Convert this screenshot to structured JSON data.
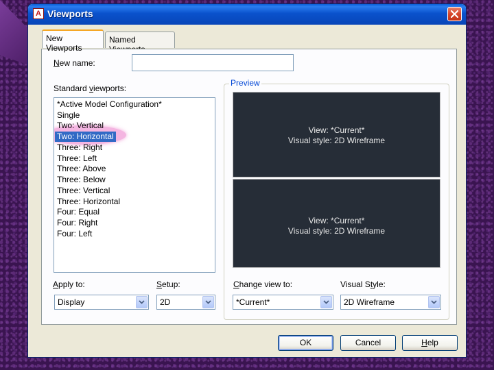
{
  "window": {
    "title": "Viewports",
    "app_icon_letter": "A"
  },
  "tabs": [
    {
      "label": "New Viewports",
      "active": true
    },
    {
      "label": "Named Viewports",
      "active": false
    }
  ],
  "new_name": {
    "label_pre": "",
    "label_mn": "N",
    "label_post": "ew name:",
    "value": ""
  },
  "standard_viewports": {
    "label_pre": "Standard ",
    "label_mn": "v",
    "label_post": "iewports:",
    "items": [
      "*Active Model Configuration*",
      "Single",
      "Two: Vertical",
      "Two: Horizontal",
      "Three: Right",
      "Three: Left",
      "Three: Above",
      "Three: Below",
      "Three: Vertical",
      "Three: Horizontal",
      "Four: Equal",
      "Four: Right",
      "Four: Left"
    ],
    "selected_index": 3
  },
  "preview": {
    "title": "Preview",
    "panes": [
      {
        "view": "View: *Current*",
        "style": "Visual style: 2D Wireframe"
      },
      {
        "view": "View: *Current*",
        "style": "Visual style: 2D Wireframe"
      }
    ],
    "background_color": "#262d37"
  },
  "apply_to": {
    "label_pre": "",
    "label_mn": "A",
    "label_post": "pply to:",
    "value": "Display"
  },
  "setup": {
    "label_pre": "",
    "label_mn": "S",
    "label_post": "etup:",
    "value": "2D"
  },
  "change_view_to": {
    "label_pre": "",
    "label_mn": "C",
    "label_post": "hange view to:",
    "value": "*Current*"
  },
  "visual_style": {
    "label_pre": "Visual S",
    "label_mn": "t",
    "label_post": "yle:",
    "value": "2D Wireframe"
  },
  "buttons": {
    "ok": "OK",
    "cancel": "Cancel",
    "help_mn": "H",
    "help_rest": "elp"
  },
  "colors": {
    "titlebar": "#0a52cc",
    "selection": "#316ac5",
    "annotation_highlight": "#eb78c8",
    "desktop": "#3a1450"
  }
}
